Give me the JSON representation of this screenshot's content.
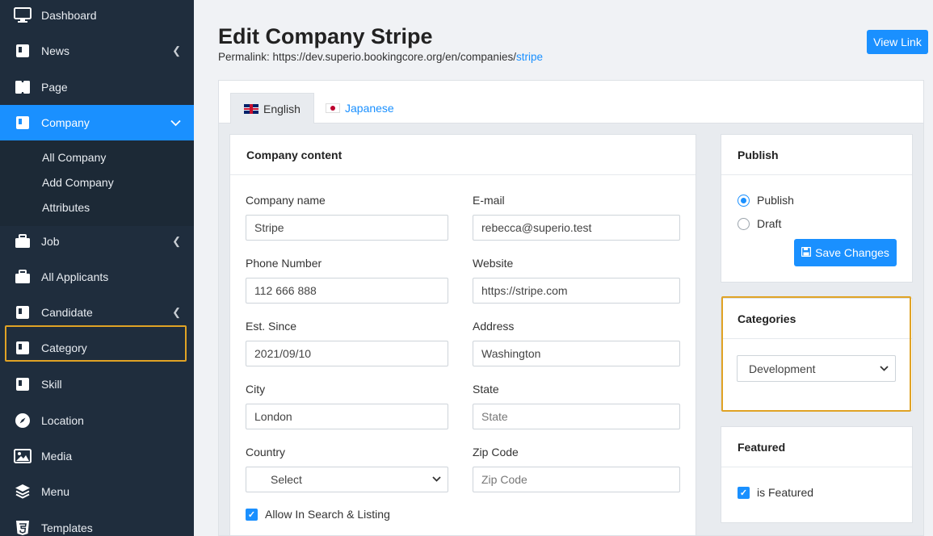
{
  "sidebar": {
    "items": [
      {
        "label": "Dashboard",
        "icon": "monitor-icon"
      },
      {
        "label": "News",
        "icon": "book-icon"
      },
      {
        "label": "Page",
        "icon": "page-icon"
      },
      {
        "label": "Company",
        "icon": "book-icon"
      },
      {
        "label": "Job",
        "icon": "briefcase-icon"
      },
      {
        "label": "All Applicants",
        "icon": "briefcase-icon"
      },
      {
        "label": "Candidate",
        "icon": "book-icon"
      },
      {
        "label": "Category",
        "icon": "book-icon"
      },
      {
        "label": "Skill",
        "icon": "book-icon"
      },
      {
        "label": "Location",
        "icon": "compass-icon"
      },
      {
        "label": "Media",
        "icon": "image-icon"
      },
      {
        "label": "Menu",
        "icon": "layers-icon"
      },
      {
        "label": "Templates",
        "icon": "html5-icon"
      }
    ],
    "submenu": [
      "All Company",
      "Add Company",
      "Attributes"
    ],
    "active_color": "#1a90ff",
    "highlight_color": "#e0a325"
  },
  "header": {
    "title": "Edit Company Stripe",
    "permalink_label": "Permalink: https://dev.superio.bookingcore.org/en/companies/",
    "permalink_slug": "stripe",
    "view_link": "View Link"
  },
  "tabs": [
    {
      "label": "English",
      "flag": "uk-flag-icon"
    },
    {
      "label": "Japanese",
      "flag": "japan-flag-icon"
    }
  ],
  "company_content": {
    "title": "Company content",
    "fields": {
      "company_name": {
        "label": "Company name",
        "value": "Stripe"
      },
      "email": {
        "label": "E-mail",
        "value": "rebecca@superio.test"
      },
      "phone": {
        "label": "Phone Number",
        "value": "112 666 888"
      },
      "website": {
        "label": "Website",
        "value": "https://stripe.com"
      },
      "est_since": {
        "label": "Est. Since",
        "value": "2021/09/10"
      },
      "address": {
        "label": "Address",
        "value": "Washington"
      },
      "city": {
        "label": "City",
        "value": "London"
      },
      "state": {
        "label": "State",
        "placeholder": "State"
      },
      "country": {
        "label": "Country",
        "value": "Select"
      },
      "zip": {
        "label": "Zip Code",
        "placeholder": "Zip Code"
      }
    },
    "allow_search": "Allow In Search & Listing"
  },
  "publish": {
    "title": "Publish",
    "option_publish": "Publish",
    "option_draft": "Draft",
    "save_label": "Save Changes"
  },
  "categories": {
    "title": "Categories",
    "selected": "Development"
  },
  "featured": {
    "title": "Featured",
    "checkbox_label": "is Featured"
  }
}
